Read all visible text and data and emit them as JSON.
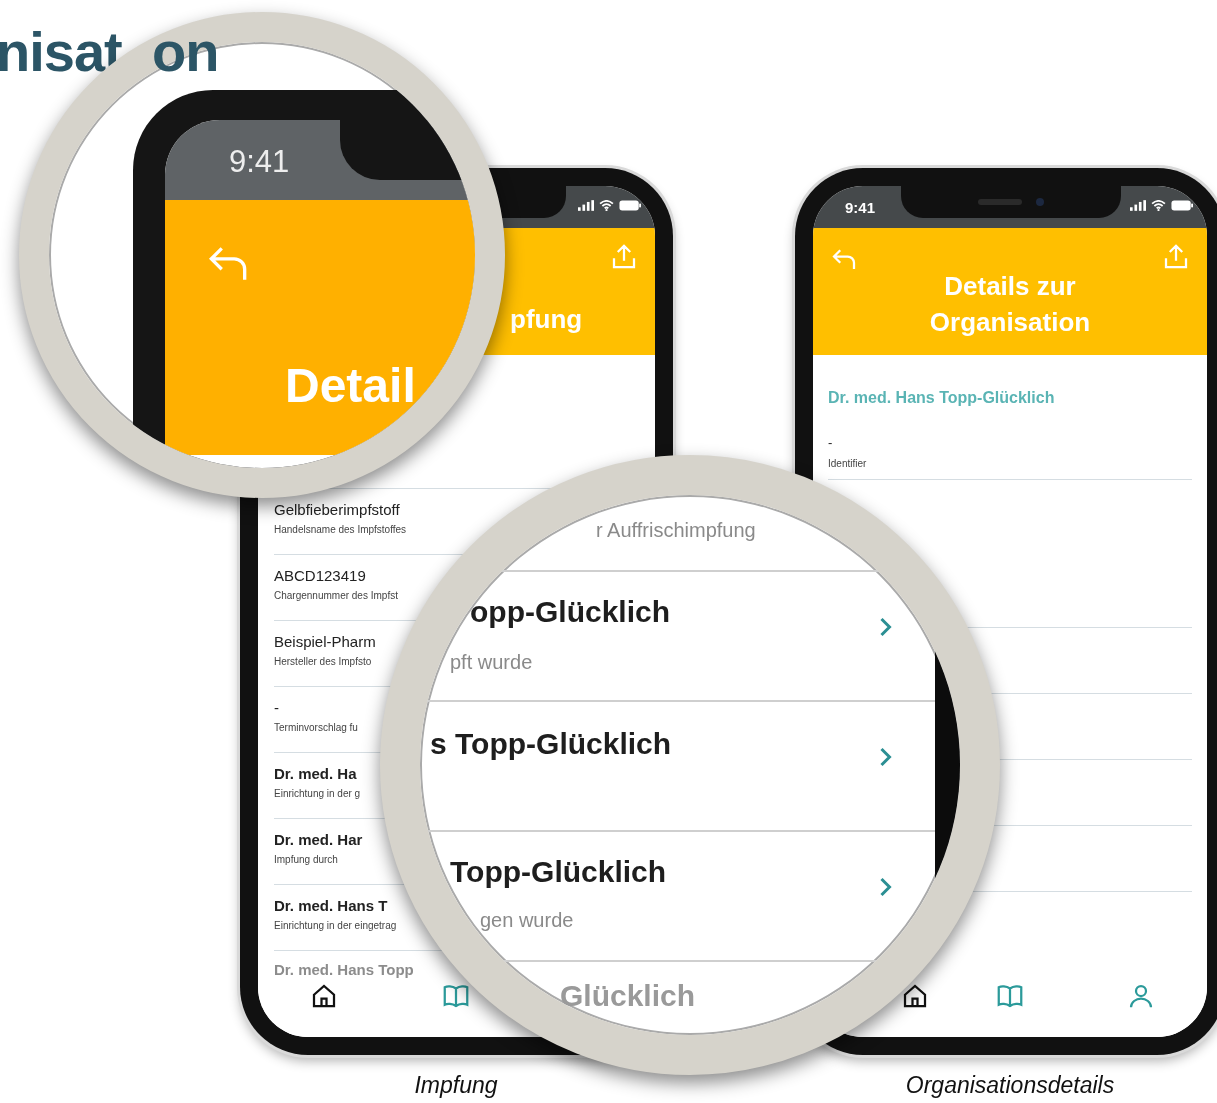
{
  "heading": {
    "left_part": "nisat",
    "right_part": "on"
  },
  "impfung_phone": {
    "title": "pfung",
    "rows": [
      {
        "kind": "plain",
        "value": "Gelbfieberimpfstoff",
        "label": "Handelsname des Impfstoffes"
      },
      {
        "kind": "plain",
        "value": "ABCD123419",
        "label": "Chargennummer des Impfst"
      },
      {
        "kind": "plain",
        "value": "Beispiel-Pharm",
        "label": "Hersteller des Impfsto"
      },
      {
        "kind": "plain",
        "value": "-",
        "label": "Terminvorschlag fu"
      },
      {
        "kind": "bold",
        "value": "Dr. med. Ha",
        "label": "Einrichtung in der g"
      },
      {
        "kind": "bold",
        "value": "Dr. med. Har",
        "label": "Impfung durch"
      },
      {
        "kind": "bold",
        "value": "Dr. med. Hans T",
        "label": "Einrichtung in der eingetrag"
      },
      {
        "kind": "faded",
        "value": "Dr. med. Hans Topp"
      }
    ],
    "tabs": [
      {
        "kind": "home",
        "highlighted": false
      },
      {
        "kind": "book",
        "highlighted": true
      }
    ]
  },
  "org_phone": {
    "time": "9:41",
    "title": "Details zur Organisation",
    "name": "Dr. med. Hans Topp-Glücklich",
    "rows": [
      {
        "value": "-",
        "label": "Identifier"
      }
    ],
    "tabs": [
      {
        "kind": "home",
        "highlighted": false
      },
      {
        "kind": "book",
        "highlighted": true
      },
      {
        "kind": "person",
        "highlighted": true
      }
    ]
  },
  "magnifier_top": {
    "time": "9:41",
    "title": "Detail"
  },
  "magnifier_bottom": {
    "rows": [
      {
        "kind": "sub",
        "text": "r Auffrischimpfung"
      },
      {
        "kind": "link",
        "title": "opp-Glücklich",
        "sub": "pft wurde"
      },
      {
        "kind": "link",
        "title": "s Topp-Glücklich"
      },
      {
        "kind": "link",
        "title": "Topp-Glücklich",
        "sub": "gen wurde"
      },
      {
        "kind": "faded",
        "title": "Glücklich"
      }
    ]
  },
  "captions": [
    "Impfung",
    "Organisationsdetails"
  ]
}
